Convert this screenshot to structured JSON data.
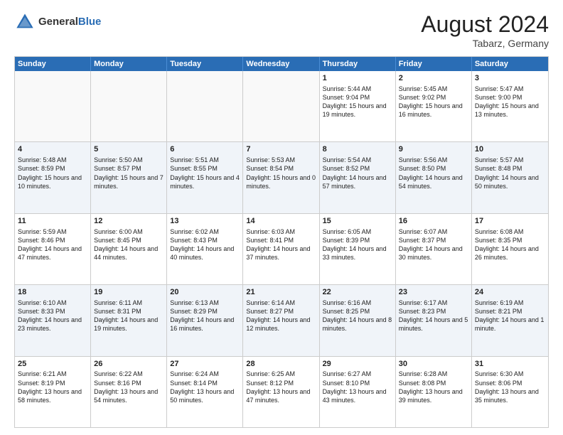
{
  "header": {
    "logo_general": "General",
    "logo_blue": "Blue",
    "month_title": "August 2024",
    "location": "Tabarz, Germany"
  },
  "calendar": {
    "days_of_week": [
      "Sunday",
      "Monday",
      "Tuesday",
      "Wednesday",
      "Thursday",
      "Friday",
      "Saturday"
    ],
    "weeks": [
      [
        {
          "day": "",
          "sunrise": "",
          "sunset": "",
          "daylight": "",
          "empty": true
        },
        {
          "day": "",
          "sunrise": "",
          "sunset": "",
          "daylight": "",
          "empty": true
        },
        {
          "day": "",
          "sunrise": "",
          "sunset": "",
          "daylight": "",
          "empty": true
        },
        {
          "day": "",
          "sunrise": "",
          "sunset": "",
          "daylight": "",
          "empty": true
        },
        {
          "day": "1",
          "sunrise": "Sunrise: 5:44 AM",
          "sunset": "Sunset: 9:04 PM",
          "daylight": "Daylight: 15 hours and 19 minutes.",
          "empty": false
        },
        {
          "day": "2",
          "sunrise": "Sunrise: 5:45 AM",
          "sunset": "Sunset: 9:02 PM",
          "daylight": "Daylight: 15 hours and 16 minutes.",
          "empty": false
        },
        {
          "day": "3",
          "sunrise": "Sunrise: 5:47 AM",
          "sunset": "Sunset: 9:00 PM",
          "daylight": "Daylight: 15 hours and 13 minutes.",
          "empty": false
        }
      ],
      [
        {
          "day": "4",
          "sunrise": "Sunrise: 5:48 AM",
          "sunset": "Sunset: 8:59 PM",
          "daylight": "Daylight: 15 hours and 10 minutes.",
          "empty": false
        },
        {
          "day": "5",
          "sunrise": "Sunrise: 5:50 AM",
          "sunset": "Sunset: 8:57 PM",
          "daylight": "Daylight: 15 hours and 7 minutes.",
          "empty": false
        },
        {
          "day": "6",
          "sunrise": "Sunrise: 5:51 AM",
          "sunset": "Sunset: 8:55 PM",
          "daylight": "Daylight: 15 hours and 4 minutes.",
          "empty": false
        },
        {
          "day": "7",
          "sunrise": "Sunrise: 5:53 AM",
          "sunset": "Sunset: 8:54 PM",
          "daylight": "Daylight: 15 hours and 0 minutes.",
          "empty": false
        },
        {
          "day": "8",
          "sunrise": "Sunrise: 5:54 AM",
          "sunset": "Sunset: 8:52 PM",
          "daylight": "Daylight: 14 hours and 57 minutes.",
          "empty": false
        },
        {
          "day": "9",
          "sunrise": "Sunrise: 5:56 AM",
          "sunset": "Sunset: 8:50 PM",
          "daylight": "Daylight: 14 hours and 54 minutes.",
          "empty": false
        },
        {
          "day": "10",
          "sunrise": "Sunrise: 5:57 AM",
          "sunset": "Sunset: 8:48 PM",
          "daylight": "Daylight: 14 hours and 50 minutes.",
          "empty": false
        }
      ],
      [
        {
          "day": "11",
          "sunrise": "Sunrise: 5:59 AM",
          "sunset": "Sunset: 8:46 PM",
          "daylight": "Daylight: 14 hours and 47 minutes.",
          "empty": false
        },
        {
          "day": "12",
          "sunrise": "Sunrise: 6:00 AM",
          "sunset": "Sunset: 8:45 PM",
          "daylight": "Daylight: 14 hours and 44 minutes.",
          "empty": false
        },
        {
          "day": "13",
          "sunrise": "Sunrise: 6:02 AM",
          "sunset": "Sunset: 8:43 PM",
          "daylight": "Daylight: 14 hours and 40 minutes.",
          "empty": false
        },
        {
          "day": "14",
          "sunrise": "Sunrise: 6:03 AM",
          "sunset": "Sunset: 8:41 PM",
          "daylight": "Daylight: 14 hours and 37 minutes.",
          "empty": false
        },
        {
          "day": "15",
          "sunrise": "Sunrise: 6:05 AM",
          "sunset": "Sunset: 8:39 PM",
          "daylight": "Daylight: 14 hours and 33 minutes.",
          "empty": false
        },
        {
          "day": "16",
          "sunrise": "Sunrise: 6:07 AM",
          "sunset": "Sunset: 8:37 PM",
          "daylight": "Daylight: 14 hours and 30 minutes.",
          "empty": false
        },
        {
          "day": "17",
          "sunrise": "Sunrise: 6:08 AM",
          "sunset": "Sunset: 8:35 PM",
          "daylight": "Daylight: 14 hours and 26 minutes.",
          "empty": false
        }
      ],
      [
        {
          "day": "18",
          "sunrise": "Sunrise: 6:10 AM",
          "sunset": "Sunset: 8:33 PM",
          "daylight": "Daylight: 14 hours and 23 minutes.",
          "empty": false
        },
        {
          "day": "19",
          "sunrise": "Sunrise: 6:11 AM",
          "sunset": "Sunset: 8:31 PM",
          "daylight": "Daylight: 14 hours and 19 minutes.",
          "empty": false
        },
        {
          "day": "20",
          "sunrise": "Sunrise: 6:13 AM",
          "sunset": "Sunset: 8:29 PM",
          "daylight": "Daylight: 14 hours and 16 minutes.",
          "empty": false
        },
        {
          "day": "21",
          "sunrise": "Sunrise: 6:14 AM",
          "sunset": "Sunset: 8:27 PM",
          "daylight": "Daylight: 14 hours and 12 minutes.",
          "empty": false
        },
        {
          "day": "22",
          "sunrise": "Sunrise: 6:16 AM",
          "sunset": "Sunset: 8:25 PM",
          "daylight": "Daylight: 14 hours and 8 minutes.",
          "empty": false
        },
        {
          "day": "23",
          "sunrise": "Sunrise: 6:17 AM",
          "sunset": "Sunset: 8:23 PM",
          "daylight": "Daylight: 14 hours and 5 minutes.",
          "empty": false
        },
        {
          "day": "24",
          "sunrise": "Sunrise: 6:19 AM",
          "sunset": "Sunset: 8:21 PM",
          "daylight": "Daylight: 14 hours and 1 minute.",
          "empty": false
        }
      ],
      [
        {
          "day": "25",
          "sunrise": "Sunrise: 6:21 AM",
          "sunset": "Sunset: 8:19 PM",
          "daylight": "Daylight: 13 hours and 58 minutes.",
          "empty": false
        },
        {
          "day": "26",
          "sunrise": "Sunrise: 6:22 AM",
          "sunset": "Sunset: 8:16 PM",
          "daylight": "Daylight: 13 hours and 54 minutes.",
          "empty": false
        },
        {
          "day": "27",
          "sunrise": "Sunrise: 6:24 AM",
          "sunset": "Sunset: 8:14 PM",
          "daylight": "Daylight: 13 hours and 50 minutes.",
          "empty": false
        },
        {
          "day": "28",
          "sunrise": "Sunrise: 6:25 AM",
          "sunset": "Sunset: 8:12 PM",
          "daylight": "Daylight: 13 hours and 47 minutes.",
          "empty": false
        },
        {
          "day": "29",
          "sunrise": "Sunrise: 6:27 AM",
          "sunset": "Sunset: 8:10 PM",
          "daylight": "Daylight: 13 hours and 43 minutes.",
          "empty": false
        },
        {
          "day": "30",
          "sunrise": "Sunrise: 6:28 AM",
          "sunset": "Sunset: 8:08 PM",
          "daylight": "Daylight: 13 hours and 39 minutes.",
          "empty": false
        },
        {
          "day": "31",
          "sunrise": "Sunrise: 6:30 AM",
          "sunset": "Sunset: 8:06 PM",
          "daylight": "Daylight: 13 hours and 35 minutes.",
          "empty": false
        }
      ]
    ]
  }
}
